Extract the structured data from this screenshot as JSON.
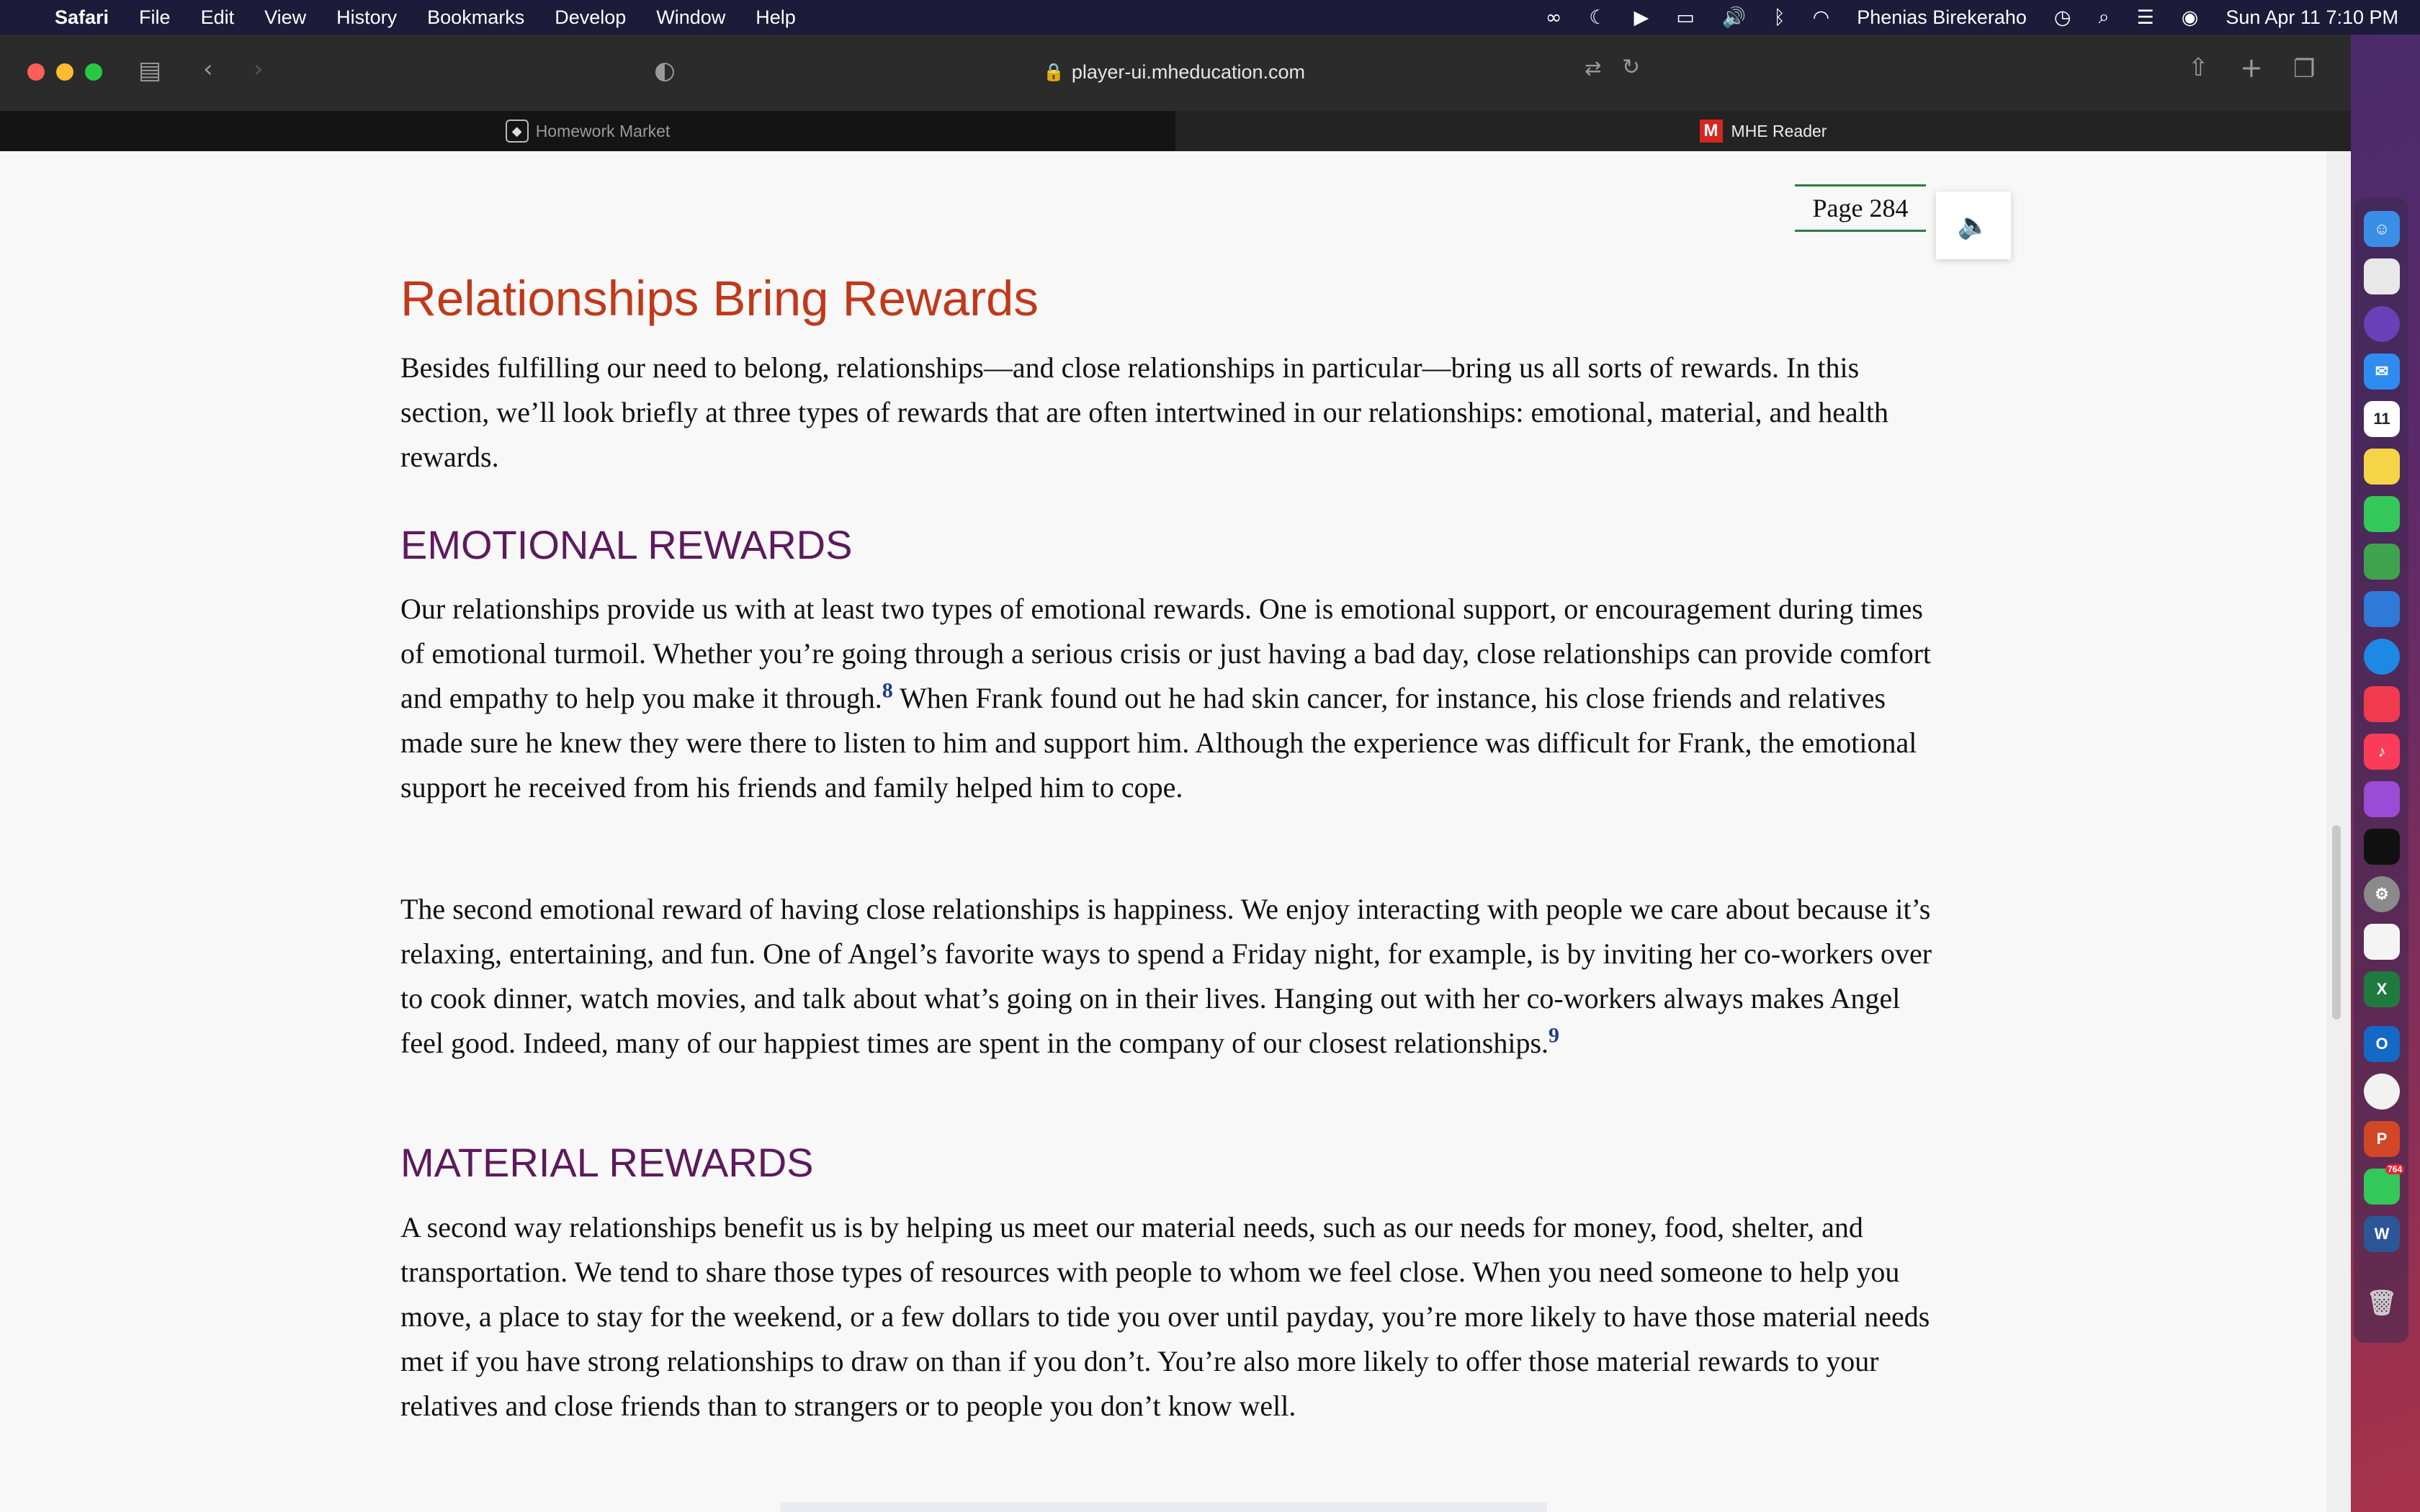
{
  "menubar": {
    "app": "Safari",
    "items": [
      "File",
      "Edit",
      "View",
      "History",
      "Bookmarks",
      "Develop",
      "Window",
      "Help"
    ],
    "user": "Phenias Birekeraho",
    "datetime": "Sun Apr 11  7:10 PM"
  },
  "browser": {
    "url": "player-ui.mheducation.com",
    "tabs": [
      {
        "label": "Homework Market",
        "active": false
      },
      {
        "label": "MHE Reader",
        "active": true
      }
    ]
  },
  "reader": {
    "page_label": "Page 284",
    "title": "Relationships Bring Rewards",
    "intro": "Besides fulfilling our need to belong, relationships—and close relationships in particular—bring us all sorts of rewards. In this section, we’ll look briefly at three types of rewards that are often intertwined in our relationships: emotional, material, and health rewards.",
    "emotional": {
      "heading": "EMOTIONAL REWARDS",
      "p1_a": "Our relationships provide us with at least two types of emotional rewards. One is emotional support, or encouragement during times of emotional turmoil. Whether you’re going through a serious crisis or just having a bad day, close relationships can provide comfort and empathy to help you make it through.",
      "p1_note": "8",
      "p1_b": " When Frank found out he had skin cancer, for instance, his close friends and relatives made sure he knew they were there to listen to him and support him. Although the experience was difficult for Frank, the emotional support he received from his friends and family helped him to cope.",
      "p2": "The second emotional reward of having close relationships is happiness. We enjoy interacting with people we care about because it’s relaxing, entertaining, and fun. One of Angel’s favorite ways to spend a Friday night, for example, is by inviting her co-workers over to cook dinner, watch movies, and talk about what’s going on in their lives. Hanging out with her co-workers always makes Angel feel good. Indeed, many of our happiest times are spent in the company of our closest relationships.",
      "p2_note": "9"
    },
    "material": {
      "heading": "MATERIAL REWARDS",
      "p1": "A second way relationships benefit us is by helping us meet our material needs, such as our needs for money, food, shelter, and transportation. We tend to share those types of resources with people to whom we feel close. When you need someone to help you move, a place to stay for the weekend, or a few dollars to tide you over until payday, you’re more likely to have those material needs met if you have strong relationships to draw on than if you don’t. You’re also more likely to offer those material rewards to your relatives and close friends than to strangers or to people you don’t know well."
    }
  },
  "dock": {
    "calendar_day": "11",
    "messages_badge": "764"
  },
  "colors": {
    "title": "#c0391a",
    "heading": "#5d1a5c",
    "page_rule": "#2e7d3a",
    "footnote": "#1f3b8a"
  }
}
